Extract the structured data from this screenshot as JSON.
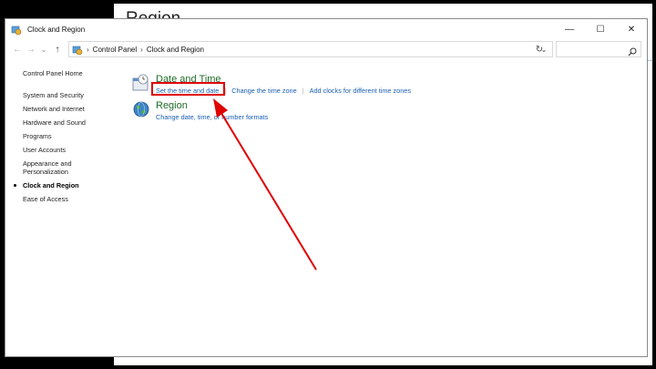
{
  "background_window": {
    "title": "Region"
  },
  "window": {
    "title": "Clock and Region"
  },
  "controls": {
    "minimize": "—",
    "maximize": "☐",
    "close": "✕"
  },
  "nav": {
    "back": "←",
    "forward": "→",
    "recent": "⌄",
    "up": "↑",
    "refresh": "↻"
  },
  "address": {
    "crumbs": [
      "Control Panel",
      "Clock and Region"
    ],
    "separator": "›",
    "dropdown": "⌄"
  },
  "sidebar": {
    "home": "Control Panel Home",
    "items": [
      {
        "label": "System and Security"
      },
      {
        "label": "Network and Internet"
      },
      {
        "label": "Hardware and Sound"
      },
      {
        "label": "Programs"
      },
      {
        "label": "User Accounts"
      },
      {
        "label": "Appearance and Personalization"
      },
      {
        "label": "Clock and Region",
        "active": true
      },
      {
        "label": "Ease of Access"
      }
    ]
  },
  "categories": [
    {
      "title": "Date and Time",
      "icon": "clock-calendar-icon",
      "links": [
        "Set the time and date",
        "Change the time zone",
        "Add clocks for different time zones"
      ]
    },
    {
      "title": "Region",
      "icon": "globe-icon",
      "links": [
        "Change date, time, or number formats"
      ]
    }
  ],
  "annotation": {
    "highlight_color": "#e00000",
    "highlighted_link": "Set the time and date"
  }
}
